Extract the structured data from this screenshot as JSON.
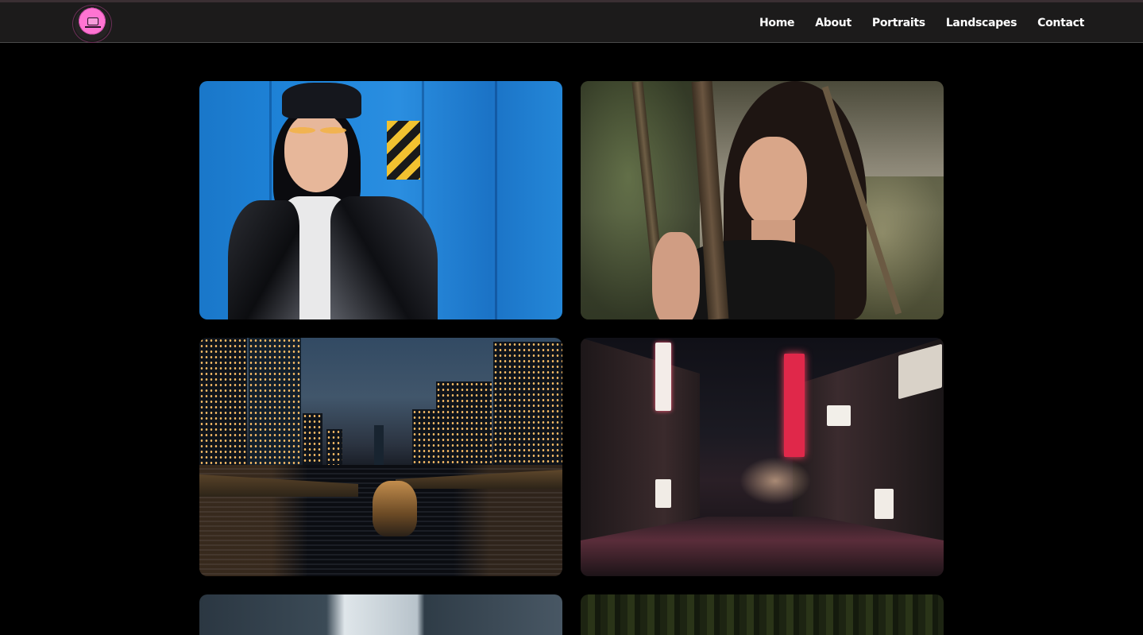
{
  "brand": {
    "logo_icon": "camera-badge-icon",
    "accent": "#ff74d2"
  },
  "nav": {
    "links": [
      {
        "label": "Home"
      },
      {
        "label": "About"
      },
      {
        "label": "Portraits"
      },
      {
        "label": "Landscapes"
      },
      {
        "label": "Contact"
      }
    ]
  },
  "gallery": {
    "photos": [
      {
        "subject": "portrait-woman-blue-wall"
      },
      {
        "subject": "portrait-woman-trees"
      },
      {
        "subject": "landscape-city-river-night"
      },
      {
        "subject": "landscape-neon-alley"
      },
      {
        "subject": "landscape-skyscrapers"
      },
      {
        "subject": "landscape-green-blur"
      }
    ]
  },
  "colors": {
    "background": "#000000",
    "navbar": "#1c1b1b",
    "nav_text": "#ffffff"
  }
}
